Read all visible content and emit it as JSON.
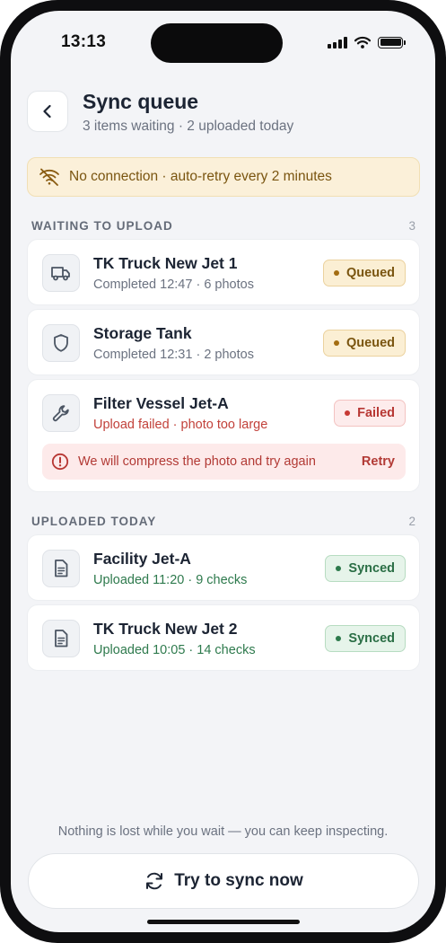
{
  "status_bar": {
    "time": "13:13"
  },
  "header": {
    "back_icon": "chevron-left-icon",
    "title": "Sync queue",
    "subtitle": "3 items waiting · 2 uploaded today"
  },
  "banner": {
    "icon": "wifi-off-icon",
    "text": "No connection · auto-retry every 2 minutes"
  },
  "waiting_section": {
    "label": "WAITING TO UPLOAD",
    "count": "3",
    "items": [
      {
        "icon": "truck-icon",
        "title": "TK Truck New Jet 1",
        "subtitle": "Completed 12:47 · 6 photos",
        "status": "Queued"
      },
      {
        "icon": "shield-icon",
        "title": "Storage Tank",
        "subtitle": "Completed 12:31 · 2 photos",
        "status": "Queued"
      },
      {
        "icon": "wrench-icon",
        "title": "Filter Vessel Jet-A",
        "subtitle": "Upload failed · photo too large",
        "status": "Failed",
        "error": {
          "icon": "alert-circle-icon",
          "message": "We will compress the photo and try again",
          "action": "Retry"
        }
      }
    ]
  },
  "uploaded_section": {
    "label": "UPLOADED TODAY",
    "count": "2",
    "items": [
      {
        "icon": "document-icon",
        "title": "Facility Jet-A",
        "subtitle": "Uploaded 11:20 · 9 checks",
        "status": "Synced"
      },
      {
        "icon": "document-icon",
        "title": "TK Truck New Jet 2",
        "subtitle": "Uploaded 10:05 · 14 checks",
        "status": "Synced"
      }
    ]
  },
  "footer": {
    "note": "Nothing is lost while you wait — you can keep inspecting.",
    "button_icon": "refresh-icon",
    "button_label": "Try to sync now"
  },
  "colors": {
    "queued": "#a36d12",
    "failed": "#c73a35",
    "synced": "#2d7a4c",
    "banner_bg": "#fbf0d9"
  }
}
